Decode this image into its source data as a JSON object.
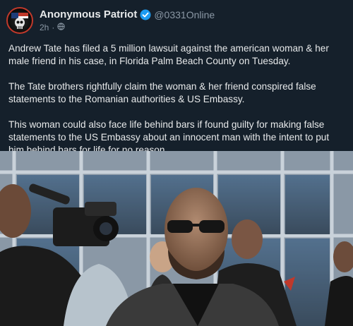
{
  "post": {
    "author_name": "Anonymous Patriot",
    "handle": "@0331Online",
    "time": "2h",
    "verified_color": "#1d9bf0",
    "audience_icon": "globe-icon",
    "paragraphs": [
      "Andrew Tate has filed a 5 million lawsuit against the american woman & her male friend in his case, in Florida Palm Beach County on Tuesday.",
      "The Tate brothers rightfully claim the woman & her friend conspired false statements to the Romanian authorities & US Embassy.",
      "This woman could also face life behind bars if found guilty for making false statements to the US Embassy about an innocent man with the intent to put him behind bars for life for no reason."
    ],
    "photo_icon": "news-photo"
  }
}
